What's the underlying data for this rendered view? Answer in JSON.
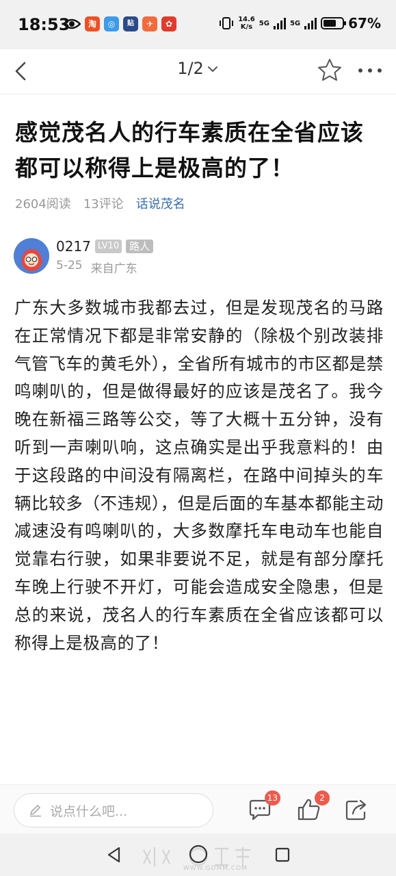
{
  "status_bar": {
    "time": "18:53",
    "speed_value": "14.6",
    "speed_unit": "K/s",
    "net1": "5G",
    "net2": "5G",
    "battery_pct": "67%",
    "battery_level": 0.67
  },
  "nav": {
    "page_indicator": "1/2"
  },
  "article": {
    "title": "感觉茂名人的行车素质在全省应该都可以称得上是极高的了！",
    "reads": "2604阅读",
    "comments": "13评论",
    "topic": "话说茂名",
    "author_name": "0217",
    "author_level": "LV10",
    "author_role": "路人",
    "date": "5-25",
    "location": "来自广东",
    "body": "广东大多数城市我都去过，但是发现茂名的马路在正常情况下都是非常安静的（除极个别改装排气管飞车的黄毛外），全省所有城市的市区都是禁鸣喇叭的，但是做得最好的应该是茂名了。我今晚在新福三路等公交，等了大概十五分钟，没有听到一声喇叭响，这点确实是出乎我意料的！由于这段路的中间没有隔离栏，在路中间掉头的车辆比较多（不违规），但是后面的车基本都能主动减速没有鸣喇叭的，大多数摩托车电动车也能自觉靠右行驶，如果非要说不足，就是有部分摩托车晚上行驶不开灯，可能会造成安全隐患，但是总的来说，茂名人的行车素质在全省应该都可以称得上是极高的了！"
  },
  "bottom_bar": {
    "comment_placeholder": "说点什么吧...",
    "comment_count": "13",
    "like_count": "2"
  },
  "watermark": {
    "url": "WWW.GDMM.COM"
  },
  "colors": {
    "topic_link": "#3b6fb6",
    "badge_red": "#f05a4a",
    "avatar_bg": "#4f7fd6"
  },
  "icons": {
    "back": "chevron-left-icon",
    "page_dropdown": "chevron-down-icon",
    "favorite": "star-icon",
    "more": "more-dots-icon",
    "comment": "comment-bubble-icon",
    "like": "thumbs-up-icon",
    "share": "share-icon"
  }
}
